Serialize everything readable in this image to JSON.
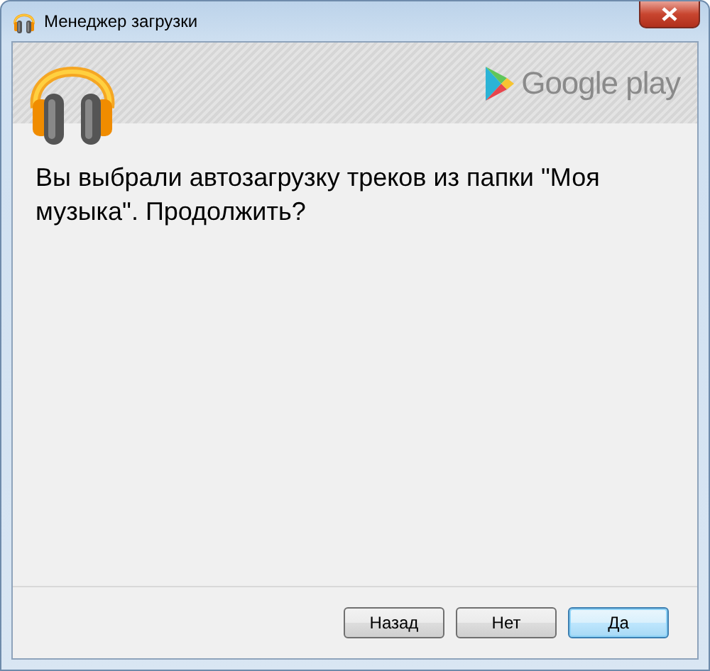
{
  "window": {
    "title": "Менеджер загрузки"
  },
  "banner": {
    "brand": "Google play"
  },
  "message": "Вы выбрали автозагрузку треков из папки \"Моя музыка\". Продолжить?",
  "buttons": [
    {
      "label": "Назад",
      "default": false
    },
    {
      "label": "Нет",
      "default": false
    },
    {
      "label": "Да",
      "default": true
    }
  ]
}
